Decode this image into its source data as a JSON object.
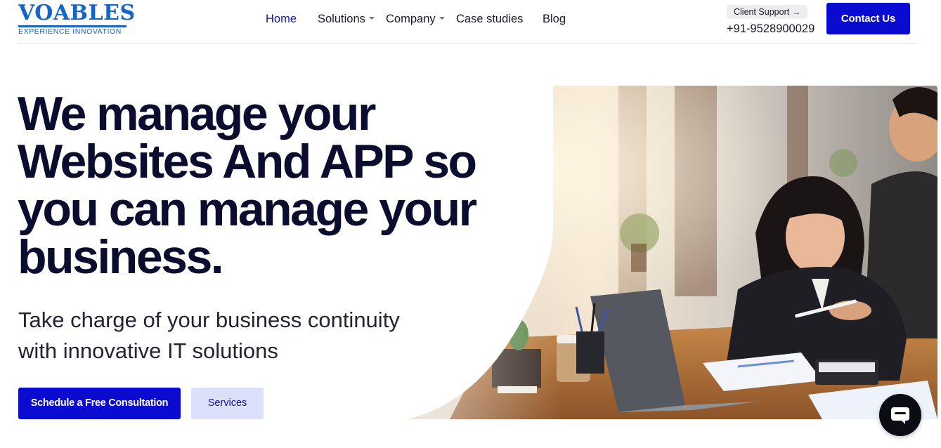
{
  "header": {
    "logo": {
      "name": "VOABLES",
      "tagline": "EXPERIENCE INNOVATION"
    },
    "nav": [
      {
        "label": "Home",
        "active": true,
        "has_dropdown": false
      },
      {
        "label": "Solutions",
        "active": false,
        "has_dropdown": true
      },
      {
        "label": "Company",
        "active": false,
        "has_dropdown": true
      },
      {
        "label": "Case studies",
        "active": false,
        "has_dropdown": false
      },
      {
        "label": "Blog",
        "active": false,
        "has_dropdown": false
      }
    ],
    "support_label": "Client Support",
    "support_icon": "arrow-right-icon",
    "phone": "+91-9528900029",
    "contact_label": "Contact Us"
  },
  "hero": {
    "headline": [
      "We manage your",
      "Websites And APP so",
      "you can manage your",
      "business."
    ],
    "subline": [
      "Take charge of your business continuity",
      "with innovative IT solutions"
    ],
    "primary_cta": "Schedule a Free Consultation",
    "secondary_cta": "Services",
    "image_subject": "office-photo"
  },
  "chat": {
    "icon": "chat-bubble-icon"
  },
  "colors": {
    "brand_blue": "#0a0ad1",
    "logo_blue": "#1565c8",
    "nav_active": "#1212a8",
    "headline": "#0b0d2e",
    "secondary_button_bg": "#dde0fb"
  }
}
